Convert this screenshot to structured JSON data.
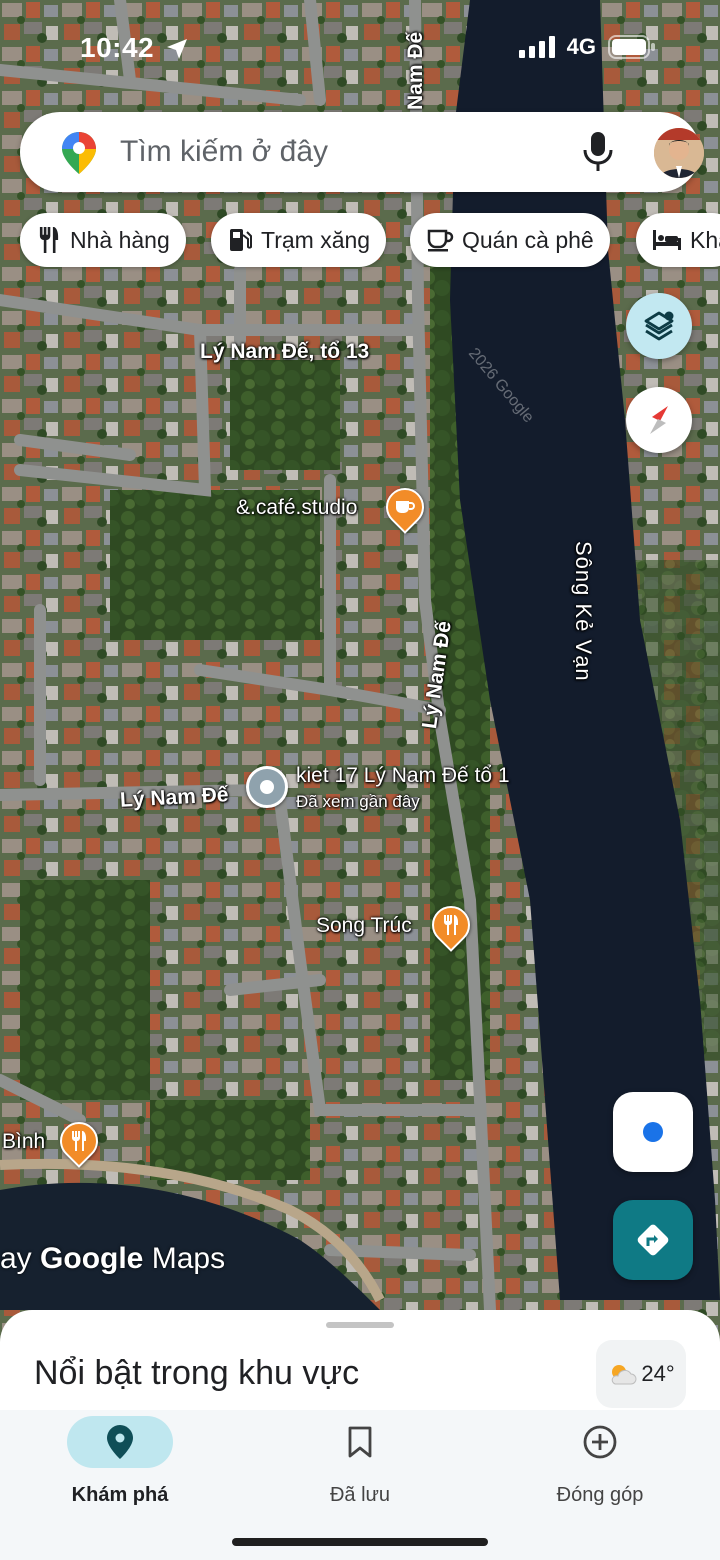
{
  "status_bar": {
    "time": "10:42",
    "network": "4G"
  },
  "search": {
    "placeholder": "Tìm kiếm ở đây"
  },
  "chips": [
    {
      "label": "Nhà hàng",
      "icon": "restaurant-icon"
    },
    {
      "label": "Trạm xăng",
      "icon": "gas-station-icon"
    },
    {
      "label": "Quán cà phê",
      "icon": "coffee-icon"
    },
    {
      "label": "Kha",
      "icon": "hotel-icon"
    }
  ],
  "map": {
    "copyright": "2026 Google",
    "road_labels": [
      "Lý Nam Đế, tổ 13",
      "Lý Nam Đế",
      "Lý Nam Đế"
    ],
    "river_label": "Sông Kẻ Vạn",
    "pois": [
      {
        "name": "&.café.studio",
        "type": "cafe"
      },
      {
        "name": "Song Trúc",
        "type": "restaurant"
      },
      {
        "name": "Bình",
        "type": "restaurant"
      }
    ],
    "recent_place": {
      "name": "kiet 17 Lý Nam Đế tổ 1",
      "subtitle": "Đã xem gần đây"
    },
    "watermark_prefix": "ay",
    "watermark_brand": "Google",
    "watermark_product": "Maps"
  },
  "sheet": {
    "title": "Nổi bật trong khu vực",
    "temperature": "24°"
  },
  "nav": {
    "explore": "Khám phá",
    "saved": "Đã lưu",
    "contribute": "Đóng góp"
  },
  "colors": {
    "accent": "#1a73e8",
    "teal": "#0f7a85",
    "poi_orange": "#f28c28",
    "nav_active": "#bfe7ef"
  }
}
